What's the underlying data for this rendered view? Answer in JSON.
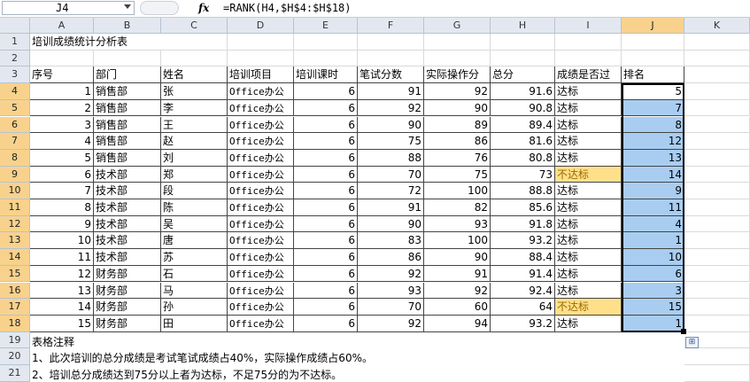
{
  "formula_bar": {
    "name_box": "J4",
    "fx": "fx",
    "formula": "=RANK(H4,$H$4:$H$18)"
  },
  "columns": [
    "A",
    "B",
    "C",
    "D",
    "E",
    "F",
    "G",
    "H",
    "I",
    "J",
    "K"
  ],
  "selected_column": "J",
  "rows": [
    "1",
    "2",
    "3",
    "4",
    "5",
    "6",
    "7",
    "8",
    "9",
    "10",
    "11",
    "12",
    "13",
    "14",
    "15",
    "16",
    "17",
    "18",
    "19",
    "20",
    "21"
  ],
  "title": "培训成绩统计分析表",
  "headers": [
    "序号",
    "部门",
    "姓名",
    "培训项目",
    "培训课时",
    "笔试分数",
    "实际操作分",
    "总分",
    "成绩是否过",
    "排名"
  ],
  "table_rows": [
    [
      "1",
      "销售部",
      "张",
      "Office办公",
      "6",
      "91",
      "92",
      "91.6",
      "达标",
      "5"
    ],
    [
      "2",
      "销售部",
      "李",
      "Office办公",
      "6",
      "92",
      "90",
      "90.8",
      "达标",
      "7"
    ],
    [
      "3",
      "销售部",
      "王",
      "Office办公",
      "6",
      "90",
      "89",
      "89.4",
      "达标",
      "8"
    ],
    [
      "4",
      "销售部",
      "赵",
      "Office办公",
      "6",
      "75",
      "86",
      "81.6",
      "达标",
      "12"
    ],
    [
      "5",
      "销售部",
      "刘",
      "Office办公",
      "6",
      "88",
      "76",
      "80.8",
      "达标",
      "13"
    ],
    [
      "6",
      "技术部",
      "郑",
      "Office办公",
      "6",
      "70",
      "75",
      "73",
      "不达标",
      "14"
    ],
    [
      "7",
      "技术部",
      "段",
      "Office办公",
      "6",
      "72",
      "100",
      "88.8",
      "达标",
      "9"
    ],
    [
      "8",
      "技术部",
      "陈",
      "Office办公",
      "6",
      "91",
      "82",
      "85.6",
      "达标",
      "11"
    ],
    [
      "9",
      "技术部",
      "吴",
      "Office办公",
      "6",
      "90",
      "93",
      "91.8",
      "达标",
      "4"
    ],
    [
      "10",
      "技术部",
      "唐",
      "Office办公",
      "6",
      "83",
      "100",
      "93.2",
      "达标",
      "1"
    ],
    [
      "11",
      "技术部",
      "苏",
      "Office办公",
      "6",
      "86",
      "90",
      "88.4",
      "达标",
      "10"
    ],
    [
      "12",
      "财务部",
      "石",
      "Office办公",
      "6",
      "92",
      "91",
      "91.4",
      "达标",
      "6"
    ],
    [
      "13",
      "财务部",
      "马",
      "Office办公",
      "6",
      "93",
      "92",
      "92.4",
      "达标",
      "3"
    ],
    [
      "14",
      "财务部",
      "孙",
      "Office办公",
      "6",
      "70",
      "60",
      "64",
      "不达标",
      "15"
    ],
    [
      "15",
      "财务部",
      "田",
      "Office办公",
      "6",
      "92",
      "94",
      "93.2",
      "达标",
      "1"
    ]
  ],
  "notes": {
    "heading": "表格注释",
    "line1": "1、此次培训的总分成绩是考试笔试成绩占40%，实际操作成绩占60%。",
    "line2": "2、培训总分成绩达到75分以上者为达标，不足75分的为不达标。"
  },
  "colors": {
    "selected_header": "#f8d28c",
    "rank_fill": "#a9cdf1",
    "fail_fill": "#ffe08a"
  }
}
